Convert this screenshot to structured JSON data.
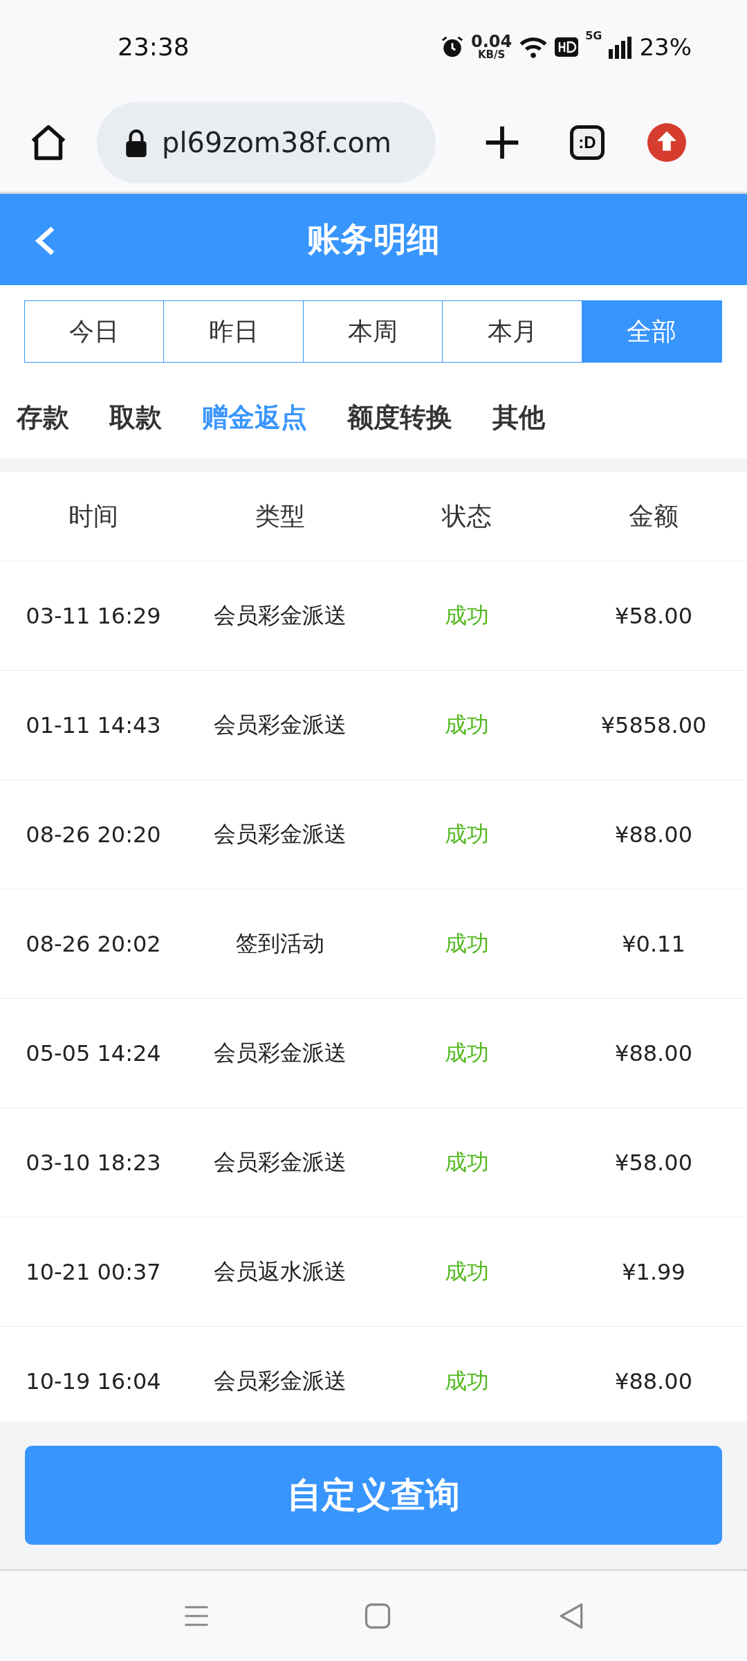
{
  "status_bar": {
    "time": "23:38",
    "speed": "0.04",
    "speed_unit": "KB/S",
    "network": "5G",
    "battery": "23%"
  },
  "browser": {
    "url": "pl69zom38f.com",
    "tab_button": ":D"
  },
  "header": {
    "title": "账务明细"
  },
  "periods": [
    {
      "label": "今日",
      "selected": false
    },
    {
      "label": "昨日",
      "selected": false
    },
    {
      "label": "本周",
      "selected": false
    },
    {
      "label": "本月",
      "selected": false
    },
    {
      "label": "全部",
      "selected": true
    }
  ],
  "categories": [
    {
      "label": "存款",
      "selected": false
    },
    {
      "label": "取款",
      "selected": false
    },
    {
      "label": "赠金返点",
      "selected": true
    },
    {
      "label": "额度转换",
      "selected": false
    },
    {
      "label": "其他",
      "selected": false
    }
  ],
  "table": {
    "columns": [
      "时间",
      "类型",
      "状态",
      "金额"
    ],
    "rows": [
      [
        "03-11 16:29",
        "会员彩金派送",
        "成功",
        "¥58.00"
      ],
      [
        "01-11 14:43",
        "会员彩金派送",
        "成功",
        "¥5858.00"
      ],
      [
        "08-26 20:20",
        "会员彩金派送",
        "成功",
        "¥88.00"
      ],
      [
        "08-26 20:02",
        "签到活动",
        "成功",
        "¥0.11"
      ],
      [
        "05-05 14:24",
        "会员彩金派送",
        "成功",
        "¥88.00"
      ],
      [
        "03-10 18:23",
        "会员彩金派送",
        "成功",
        "¥58.00"
      ],
      [
        "10-21 00:37",
        "会员返水派送",
        "成功",
        "¥1.99"
      ],
      [
        "10-19 16:04",
        "会员彩金派送",
        "成功",
        "¥88.00"
      ]
    ]
  },
  "query_button": "自定义查询"
}
